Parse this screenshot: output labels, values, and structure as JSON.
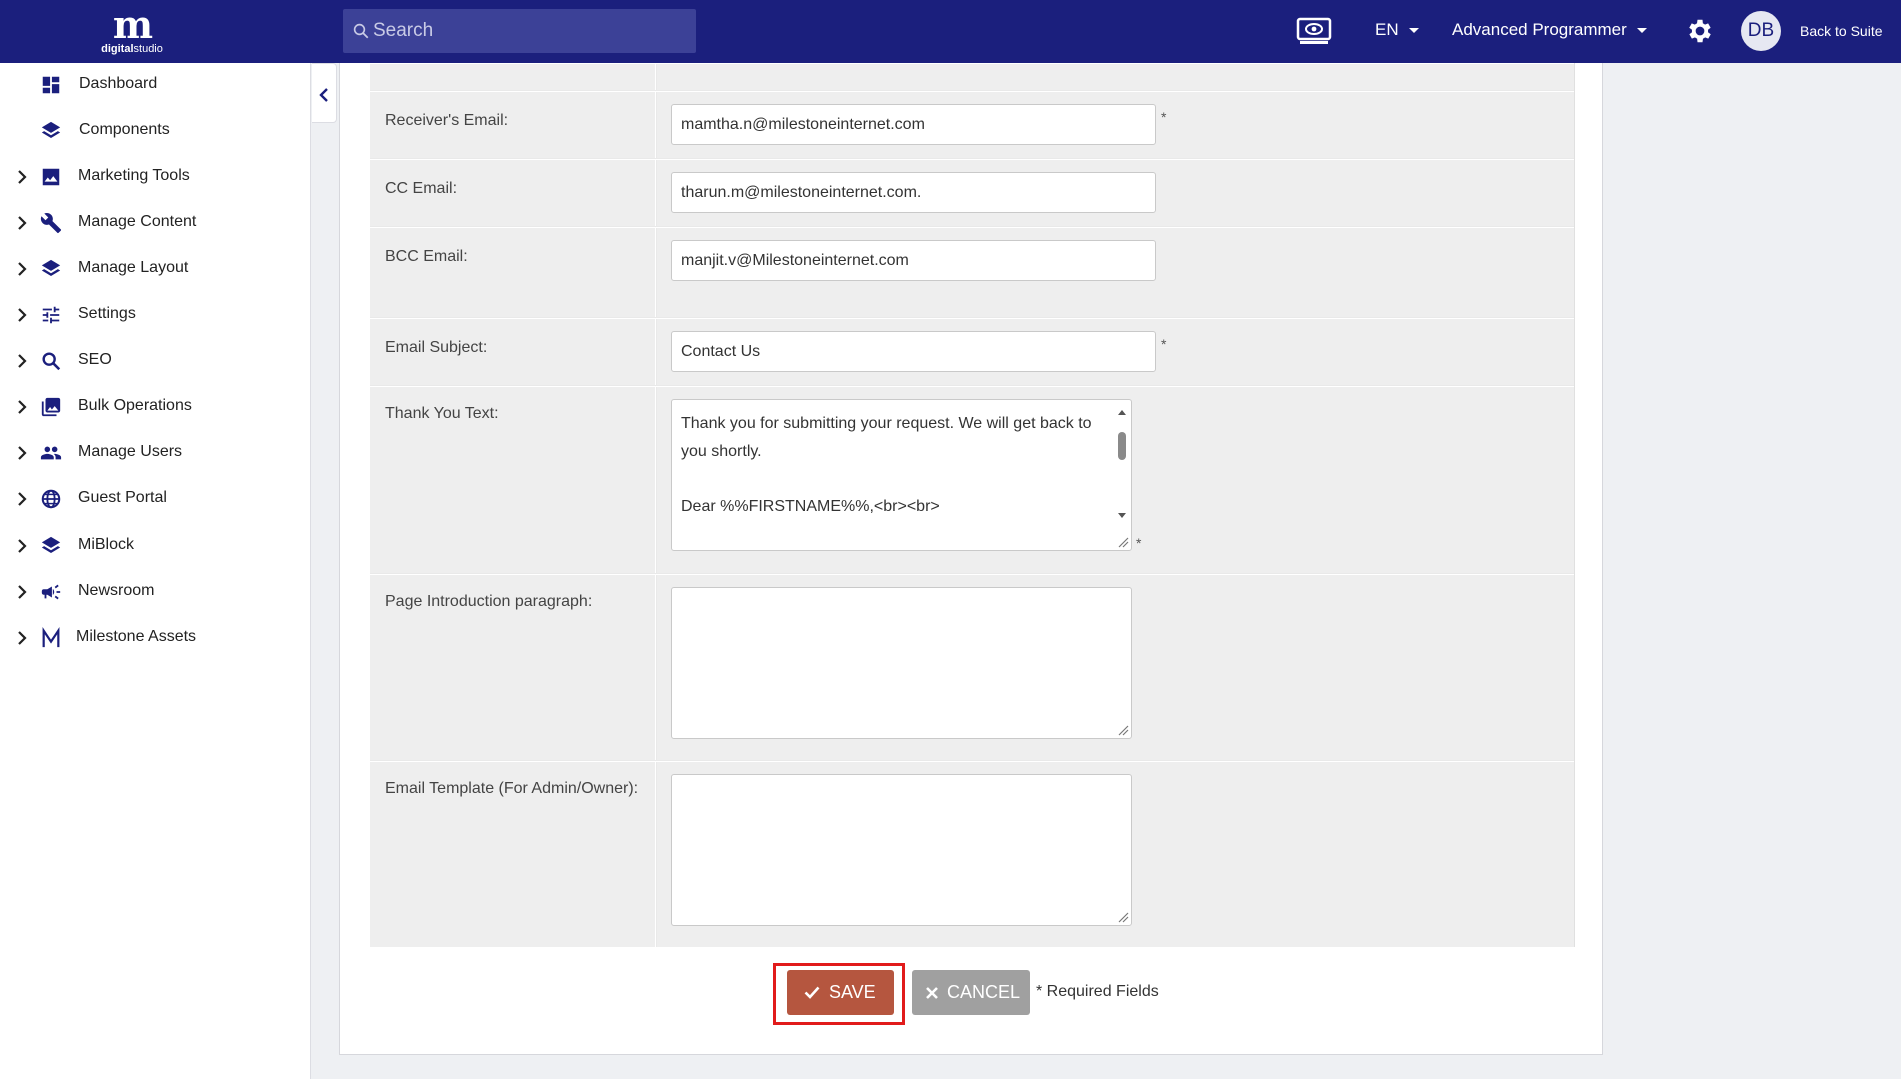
{
  "header": {
    "logo_mark": "m",
    "logo_word_bold": "digital",
    "logo_word_light": "studio",
    "search_placeholder": "Search",
    "language": "EN",
    "role": "Advanced Programmer",
    "avatar_initials": "DB",
    "back_label": "Back to Suite"
  },
  "sidebar": {
    "items": [
      {
        "label": "Dashboard",
        "icon": "dashboard-icon",
        "expandable": false
      },
      {
        "label": "Components",
        "icon": "layers-icon",
        "expandable": false
      },
      {
        "label": "Marketing Tools",
        "icon": "image-icon",
        "expandable": true
      },
      {
        "label": "Manage Content",
        "icon": "wrench-icon",
        "expandable": true
      },
      {
        "label": "Manage Layout",
        "icon": "layers-icon",
        "expandable": true
      },
      {
        "label": "Settings",
        "icon": "sliders-icon",
        "expandable": true
      },
      {
        "label": "SEO",
        "icon": "search-icon",
        "expandable": true
      },
      {
        "label": "Bulk Operations",
        "icon": "photo-library-icon",
        "expandable": true
      },
      {
        "label": "Manage Users",
        "icon": "people-icon",
        "expandable": true
      },
      {
        "label": "Guest Portal",
        "icon": "globe-icon",
        "expandable": true
      },
      {
        "label": "MiBlock",
        "icon": "layers-icon",
        "expandable": true
      },
      {
        "label": "Newsroom",
        "icon": "megaphone-icon",
        "expandable": true
      },
      {
        "label": "Milestone Assets",
        "icon": "milestone-logo-icon",
        "expandable": true
      }
    ]
  },
  "form": {
    "receiver_label": "Receiver's Email:",
    "receiver_value": "mamtha.n@milestoneinternet.com",
    "cc_label": "CC Email:",
    "cc_value": "tharun.m@milestoneinternet.com.",
    "bcc_label": "BCC Email:",
    "bcc_value": "manjit.v@Milestoneinternet.com",
    "subject_label": "Email Subject:",
    "subject_value": "Contact Us",
    "thankyou_label": "Thank You Text:",
    "thankyou_line1": "Thank you for submitting your request. We will get back to you shortly.",
    "thankyou_line2": "Dear %%FIRSTNAME%%,<br><br>",
    "intro_label": "Page Introduction paragraph:",
    "intro_value": "",
    "template_label": "Email Template (For Admin/Owner):",
    "template_value": "",
    "required_mark": "*"
  },
  "actions": {
    "save_label": "SAVE",
    "cancel_label": "CANCEL",
    "required_note": "* Required Fields"
  },
  "colors": {
    "header_bg": "#1b1f7d",
    "accent_icon": "#1b1f7d",
    "save_bg": "#b5563f",
    "cancel_bg": "#a0a0a0",
    "highlight": "#e11b1b"
  }
}
